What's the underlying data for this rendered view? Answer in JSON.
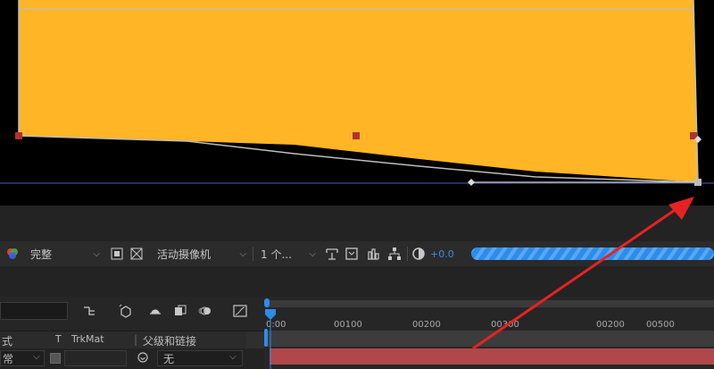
{
  "toolbar": {
    "resolution": "完整",
    "camera": "活动摄像机",
    "views": "1 个...",
    "exposure": "+0.0"
  },
  "timeline": {
    "ruler_labels": [
      "0:00",
      "00100",
      "00200",
      "00300",
      "00200",
      "00500"
    ],
    "header": {
      "mode": "式",
      "t": "T",
      "trkmat": "TrkMat",
      "parent": "父级和链接"
    },
    "row": {
      "mode": "常",
      "parent_value": "无"
    }
  },
  "colors": {
    "shape_fill": "#ffb525",
    "timeline_accent": "#2d8ceb",
    "layer_bar": "#b0474b",
    "annotation_arrow": "#e82222"
  }
}
